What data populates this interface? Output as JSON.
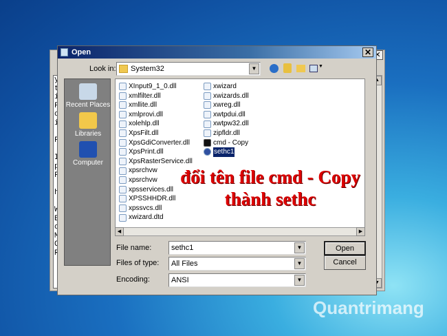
{
  "background_window": {
    "text_column": [
      "y",
      "t",
      "i",
      "F",
      "c",
      "i",
      "",
      "F",
      "",
      "I",
      "p",
      "F",
      "",
      "h",
      "",
      "W",
      "E",
      "c",
      "M",
      "C",
      "R"
    ],
    "close_label": "✕"
  },
  "dialog": {
    "title": "Open",
    "close_label": "✕",
    "look_in_label": "Look in:",
    "look_in_value": "System32",
    "places": [
      {
        "label": "Recent Places"
      },
      {
        "label": "Libraries"
      },
      {
        "label": "Computer"
      }
    ],
    "files_col1": [
      "XInput9_1_0.dll",
      "xmlfilter.dll",
      "xmllite.dll",
      "xmlprovi.dll",
      "xolehlp.dll",
      "XpsFilt.dll",
      "XpsGdiConverter.dll",
      "XpsPrint.dll",
      "XpsRasterService.dll",
      "xpsrchvw",
      "xpsrchvw",
      "xpsservices.dll",
      "XPSSHHDR.dll",
      "xpssvcs.dll",
      "xwizard.dtd"
    ],
    "files_col2": [
      "xwizard",
      "xwizards.dll",
      "xwreg.dll",
      "xwtpdui.dll",
      "xwtpw32.dll",
      "zipfldr.dll",
      "cmd - Copy",
      "sethc1"
    ],
    "selected_file": "sethc1",
    "annotation_line1": "đổi tên file cmd - Copy",
    "annotation_line2": "thành sethc",
    "file_name_label": "File name:",
    "file_name_value": "sethc1",
    "file_type_label": "Files of type:",
    "file_type_value": "All Files",
    "encoding_label": "Encoding:",
    "encoding_value": "ANSI",
    "open_label": "Open",
    "cancel_label": "Cancel"
  },
  "watermark": "Quantrimang"
}
